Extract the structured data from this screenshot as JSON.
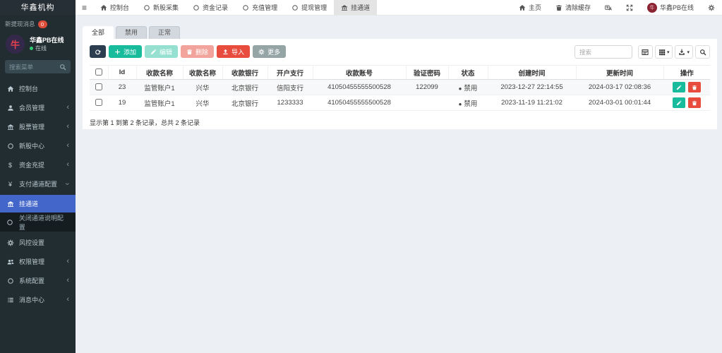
{
  "brand": {
    "title": "华鑫机构"
  },
  "sidebar": {
    "notice_label": "新提现消息",
    "notice_badge": "0",
    "user_name": "华鑫PB在线",
    "user_status": "在线",
    "user_avatar_glyph": "牛",
    "search_placeholder": "搜索菜单",
    "menu": [
      {
        "label": "控制台",
        "arrow": ""
      },
      {
        "label": "会员管理",
        "arrow": "‹"
      },
      {
        "label": "股票管理",
        "arrow": "‹"
      },
      {
        "label": "新股中心",
        "arrow": "‹"
      },
      {
        "label": "资金充提",
        "arrow": "‹"
      },
      {
        "label": "支付通道配置",
        "arrow": "‹"
      },
      {
        "label": "挂通道",
        "arrow": ""
      },
      {
        "label": "关闭通道说明配置",
        "arrow": ""
      },
      {
        "label": "风控设置",
        "arrow": ""
      },
      {
        "label": "权限管理",
        "arrow": "‹"
      },
      {
        "label": "系统配置",
        "arrow": "‹"
      },
      {
        "label": "消息中心",
        "arrow": "‹"
      }
    ]
  },
  "navbar": {
    "menu": [
      {
        "label": "控制台"
      },
      {
        "label": "新股采集"
      },
      {
        "label": "资金记录"
      },
      {
        "label": "充值管理"
      },
      {
        "label": "提现管理"
      },
      {
        "label": "挂通道"
      }
    ],
    "home": "主页",
    "clear_cache": "清除缓存",
    "user": "华鑫PB在线"
  },
  "tabs": {
    "all": "全部",
    "disabled": "禁用",
    "normal": "正常"
  },
  "toolbar": {
    "add": "添加",
    "edit": "编辑",
    "remove": "删除",
    "import": "导入",
    "more": "更多"
  },
  "search_placeholder": "搜索",
  "table": {
    "columns": [
      "Id",
      "收款名称",
      "收款名称",
      "收款银行",
      "开户支行",
      "收款账号",
      "验证密码",
      "状态",
      "创建时间",
      "更新时间",
      "操作"
    ],
    "rows": [
      {
        "id": "23",
        "name": "监管账户1",
        "name2": "兴华",
        "bank": "北京银行",
        "branch": "信阳支行",
        "account": "41050455555500528",
        "code": "122099",
        "status_dot": "●",
        "status": "禁用",
        "created": "2023-12-27 22:14:55",
        "updated": "2024-03-17 02:08:36"
      },
      {
        "id": "19",
        "name": "监管账户1",
        "name2": "兴华",
        "bank": "北京银行",
        "branch": "1233333",
        "account": "41050455555500528",
        "code": "",
        "status_dot": "●",
        "status": "禁用",
        "created": "2023-11-19 11:21:02",
        "updated": "2024-03-01 00:01:44"
      }
    ]
  },
  "summary": "显示第 1 到第 2 条记录，总共 2 条记录",
  "colors": {
    "sidebar_bg": "#222d32",
    "active_blue": "#4266c9",
    "teal": "#18bc9c",
    "red": "#e74c3c",
    "dark_navy": "#2c3e50",
    "gray_button": "#95a5a6",
    "badge_red": "#dd4b39",
    "online_green": "#2ecc71",
    "content_bg": "#ecf0f5",
    "status_dot": "#444444"
  }
}
